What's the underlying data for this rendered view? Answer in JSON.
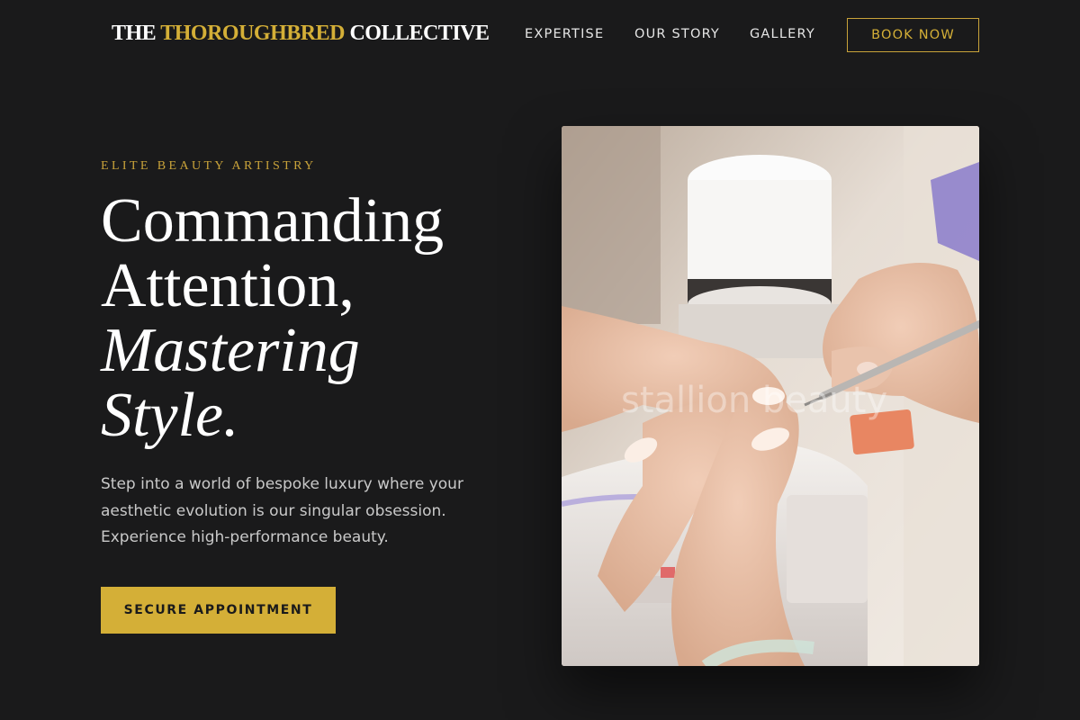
{
  "header": {
    "brand": {
      "part1": "THE ",
      "part2": "THOROUGHBRED",
      "part3": " COLLECTIVE"
    },
    "nav": {
      "expertise": "EXPERTISE",
      "our_story": "OUR STORY",
      "gallery": "GALLERY"
    },
    "book_now": "BOOK NOW"
  },
  "hero": {
    "eyebrow": "ELITE BEAUTY ARTISTRY",
    "headline": {
      "line1": "Commanding",
      "line2": "Attention,",
      "line3": "Mastering",
      "line4": "Style",
      "period": "."
    },
    "lead": "Step into a world of bespoke luxury where your aesthetic evolution is our singular obsession. Experience high-performance beauty.",
    "cta": "SECURE APPOINTMENT",
    "image_watermark": "stallion beauty"
  },
  "colors": {
    "background": "#1a1a1b",
    "accent_gold": "#d4af37",
    "text_light": "#ffffff",
    "text_muted": "#c9c9c9"
  },
  "icons": {
    "hero_image": "manicure-photo"
  }
}
